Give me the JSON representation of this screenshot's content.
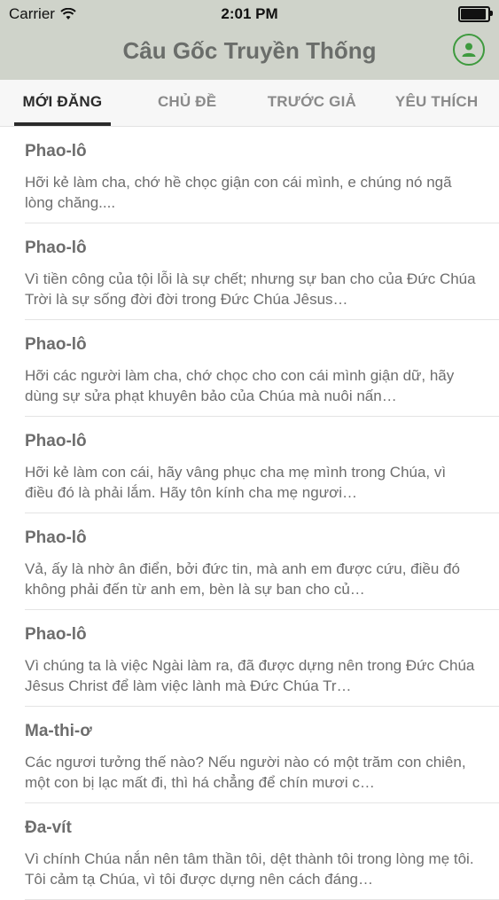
{
  "status_bar": {
    "carrier": "Carrier",
    "time": "2:01 PM",
    "battery_level": 1.0
  },
  "header": {
    "title": "Câu Gốc Truyền Thống",
    "account_icon": "person-icon",
    "accent_color": "#3e9a3e"
  },
  "tabs": [
    {
      "label": "MỚI ĐĂNG",
      "active": true
    },
    {
      "label": "CHỦ ĐỀ",
      "active": false
    },
    {
      "label": "TRƯỚC GIẢ",
      "active": false
    },
    {
      "label": "YÊU THÍCH",
      "active": false
    }
  ],
  "items": [
    {
      "author": "Phao-lô",
      "excerpt": "Hỡi kẻ làm cha, chớ hề chọc giận con cái mình, e chúng nó ngã lòng chăng...."
    },
    {
      "author": "Phao-lô",
      "excerpt": "Vì tiền công của tội lỗi là sự chết; nhưng sự ban cho của Đức Chúa Trời là sự sống đời đời trong Đức Chúa Jêsus…"
    },
    {
      "author": "Phao-lô",
      "excerpt": "Hỡi các người làm cha, chớ chọc cho con cái mình giận dữ, hãy dùng sự sửa phạt khuyên bảo của Chúa mà nuôi nấn…"
    },
    {
      "author": "Phao-lô",
      "excerpt": "Hỡi kẻ làm con cái, hãy vâng phục cha mẹ mình trong Chúa, vì điều đó là phải lắm. Hãy tôn kính cha mẹ ngươi…"
    },
    {
      "author": "Phao-lô",
      "excerpt": "Vả, ấy là nhờ ân điển, bởi đức tin, mà anh em được cứu, điều đó không phải đến từ anh em, bèn là sự ban cho củ…"
    },
    {
      "author": "Phao-lô",
      "excerpt": "Vì chúng ta là việc Ngài làm ra, đã được dựng nên trong Đức Chúa Jêsus Christ để làm việc lành mà Đức Chúa Tr…"
    },
    {
      "author": "Ma-thi-ơ",
      "excerpt": "Các ngươi tưởng thế nào? Nếu người nào có một trăm con chiên, một con bị lạc mất đi, thì há chẳng để chín mươi c…"
    },
    {
      "author": "Đa-vít",
      "excerpt": "Vì chính Chúa nắn nên tâm thần tôi, dệt thành tôi trong lòng mẹ tôi. Tôi cảm tạ Chúa, vì tôi được dựng nên cách đáng…"
    }
  ]
}
